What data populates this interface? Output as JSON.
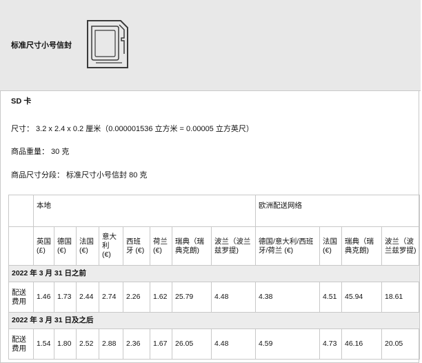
{
  "header": {
    "title": "标准尺寸小号信封"
  },
  "item": {
    "name": "SD 卡",
    "dimensions": "尺寸： 3.2 x 2.4 x 0.2 厘米（0.000001536 立方米 = 0.00005 立方英尺）",
    "weight": "商品重量： 30 克",
    "size_tier": "商品尺寸分段： 标准尺寸小号信封 80 克"
  },
  "table": {
    "group_local": "本地",
    "group_efn": "欧洲配送网络",
    "columns": [
      "英国 (£)",
      "德国 (€)",
      "法国 (€)",
      "意大利 (€)",
      "西班牙 (€)",
      "荷兰 (€)",
      "瑞典（瑞典克朗)",
      "波兰（波兰兹罗提)",
      "德国/意大利/西班牙/荷兰 (€)",
      "法国 (€)",
      "瑞典（瑞典克朗)",
      "波兰（波兰兹罗提)"
    ],
    "sections": [
      {
        "label": "2022 年 3 月 31 日之前",
        "row_label": "配送费用",
        "values": [
          "1.46",
          "1.73",
          "2.44",
          "2.74",
          "2.26",
          "1.62",
          "25.79",
          "4.48",
          "4.38",
          "4.51",
          "45.94",
          "18.61"
        ]
      },
      {
        "label": "2022 年 3 月 31 日及之后",
        "row_label": "配送费用",
        "values": [
          "1.54",
          "1.80",
          "2.52",
          "2.88",
          "2.36",
          "1.67",
          "26.05",
          "4.48",
          "4.59",
          "4.73",
          "46.16",
          "20.05"
        ]
      }
    ]
  }
}
